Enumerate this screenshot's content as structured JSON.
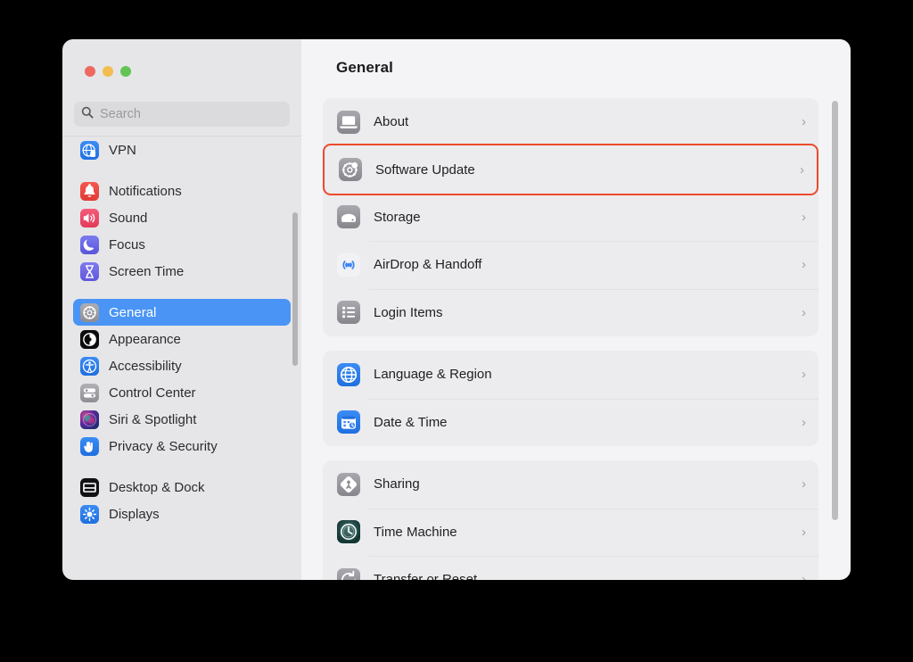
{
  "window": {
    "traffic_lights": [
      {
        "name": "close",
        "color": "#ec6a5f"
      },
      {
        "name": "minimize",
        "color": "#f4bd4f"
      },
      {
        "name": "zoom",
        "color": "#61c554"
      }
    ]
  },
  "search": {
    "value": "",
    "placeholder": "Search",
    "icon": "search-icon"
  },
  "sidebar": {
    "groups": [
      {
        "items": [
          {
            "label": "VPN",
            "icon": "vpn-icon",
            "selected": false
          }
        ]
      },
      {
        "items": [
          {
            "label": "Notifications",
            "icon": "notifications-icon",
            "selected": false
          },
          {
            "label": "Sound",
            "icon": "sound-icon",
            "selected": false
          },
          {
            "label": "Focus",
            "icon": "focus-icon",
            "selected": false
          },
          {
            "label": "Screen Time",
            "icon": "screen-time-icon",
            "selected": false
          }
        ]
      },
      {
        "items": [
          {
            "label": "General",
            "icon": "general-icon",
            "selected": true
          },
          {
            "label": "Appearance",
            "icon": "appearance-icon",
            "selected": false
          },
          {
            "label": "Accessibility",
            "icon": "accessibility-icon",
            "selected": false
          },
          {
            "label": "Control Center",
            "icon": "control-center-icon",
            "selected": false
          },
          {
            "label": "Siri & Spotlight",
            "icon": "siri-spotlight-icon",
            "selected": false
          },
          {
            "label": "Privacy & Security",
            "icon": "privacy-security-icon",
            "selected": false
          }
        ]
      },
      {
        "items": [
          {
            "label": "Desktop & Dock",
            "icon": "desktop-dock-icon",
            "selected": false
          },
          {
            "label": "Displays",
            "icon": "displays-icon",
            "selected": false
          }
        ]
      }
    ],
    "selected_accent": "#4a94f5"
  },
  "content": {
    "title": "General",
    "highlight_color": "#ec4a2c",
    "chevron": "›",
    "groups": [
      {
        "rows": [
          {
            "label": "About",
            "icon": "about-icon",
            "highlighted": false
          },
          {
            "label": "Software Update",
            "icon": "software-update-icon",
            "highlighted": true
          },
          {
            "label": "Storage",
            "icon": "storage-icon",
            "highlighted": false
          },
          {
            "label": "AirDrop & Handoff",
            "icon": "airdrop-handoff-icon",
            "highlighted": false
          },
          {
            "label": "Login Items",
            "icon": "login-items-icon",
            "highlighted": false
          }
        ]
      },
      {
        "rows": [
          {
            "label": "Language & Region",
            "icon": "language-region-icon",
            "highlighted": false
          },
          {
            "label": "Date & Time",
            "icon": "date-time-icon",
            "highlighted": false
          }
        ]
      },
      {
        "rows": [
          {
            "label": "Sharing",
            "icon": "sharing-icon",
            "highlighted": false
          },
          {
            "label": "Time Machine",
            "icon": "time-machine-icon",
            "highlighted": false
          },
          {
            "label": "Transfer or Reset",
            "icon": "transfer-reset-icon",
            "highlighted": false
          }
        ]
      }
    ]
  }
}
